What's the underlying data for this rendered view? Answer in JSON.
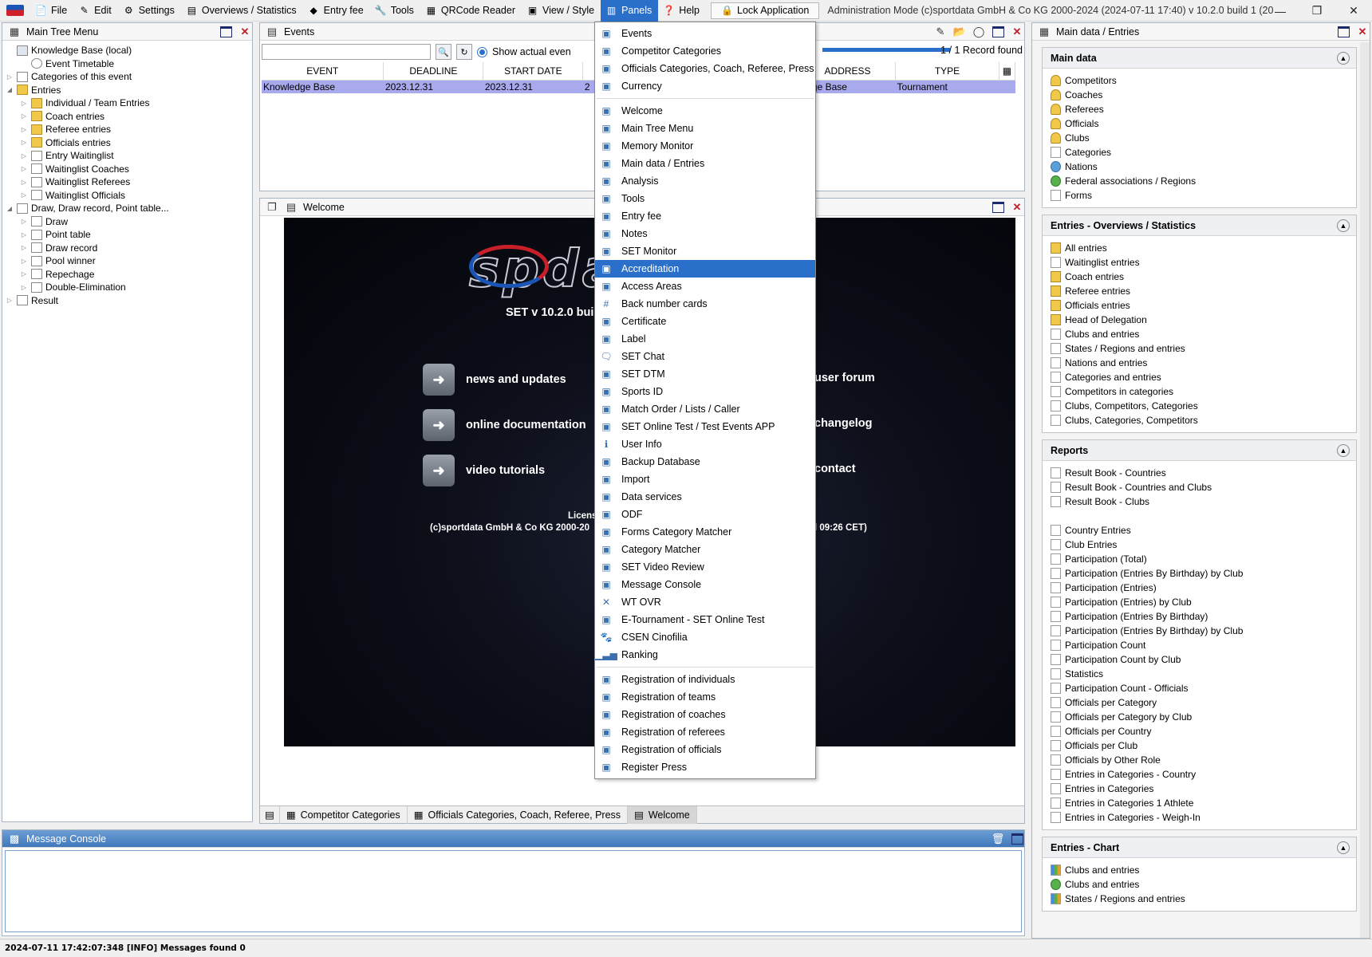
{
  "menubar": {
    "items": [
      {
        "label": "File",
        "icon": "file-icon"
      },
      {
        "label": "Edit",
        "icon": "edit-icon"
      },
      {
        "label": "Settings",
        "icon": "gear-icon"
      },
      {
        "label": "Overviews / Statistics",
        "icon": "overview-icon"
      },
      {
        "label": "Entry fee",
        "icon": "money-icon"
      },
      {
        "label": "Tools",
        "icon": "wrench-icon"
      },
      {
        "label": "QRCode Reader",
        "icon": "qrcode-icon"
      },
      {
        "label": "View / Style",
        "icon": "view-icon"
      },
      {
        "label": "Panels",
        "icon": "panels-icon"
      },
      {
        "label": "Help",
        "icon": "help-icon"
      }
    ],
    "lock_label": "Lock Application",
    "title": "Administration Mode (c)sportdata GmbH & Co KG 2000-2024 (2024-07-11 17:40)  v 10.2.0 build 1 (2024-06..."
  },
  "main_tree": {
    "title": "Main Tree Menu",
    "items": [
      {
        "label": "Knowledge Base (local)",
        "level": 0,
        "icon": "database-icon"
      },
      {
        "label": "Event Timetable",
        "level": 1,
        "icon": "clock-icon"
      },
      {
        "label": "Categories of this event",
        "level": 0,
        "icon": "categories-icon"
      },
      {
        "label": "Entries",
        "level": 0,
        "icon": "folder-icon"
      },
      {
        "label": "Individual / Team Entries",
        "level": 1,
        "icon": "folder-icon"
      },
      {
        "label": "Coach entries",
        "level": 1,
        "icon": "folder-icon"
      },
      {
        "label": "Referee entries",
        "level": 1,
        "icon": "folder-icon"
      },
      {
        "label": "Officials entries",
        "level": 1,
        "icon": "folder-icon"
      },
      {
        "label": "Entry Waitinglist",
        "level": 1,
        "icon": "document-icon"
      },
      {
        "label": "Waitinglist Coaches",
        "level": 1,
        "icon": "document-icon"
      },
      {
        "label": "Waitinglist Referees",
        "level": 1,
        "icon": "document-icon"
      },
      {
        "label": "Waitinglist Officials",
        "level": 1,
        "icon": "document-icon"
      },
      {
        "label": "Draw, Draw record, Point table...",
        "level": 0,
        "icon": "draw-icon"
      },
      {
        "label": "Draw",
        "level": 1,
        "icon": "list-icon"
      },
      {
        "label": "Point table",
        "level": 1,
        "icon": "list-icon"
      },
      {
        "label": "Draw record",
        "level": 1,
        "icon": "document-icon"
      },
      {
        "label": "Pool winner",
        "level": 1,
        "icon": "table-icon"
      },
      {
        "label": "Repechage",
        "level": 1,
        "icon": "document-icon"
      },
      {
        "label": "Double-Elimination",
        "level": 1,
        "icon": "bracket-icon"
      },
      {
        "label": "Result",
        "level": 0,
        "icon": "result-icon"
      }
    ]
  },
  "events": {
    "title": "Events",
    "show_actual_label": "Show actual even",
    "record_count": "1 / 1 Record found",
    "columns": [
      "EVENT",
      "DEADLINE",
      "START DATE",
      "ADDRESS",
      "TYPE"
    ],
    "row": {
      "event": "Knowledge Base",
      "deadline": "2023.12.31",
      "start": "2023.12.31",
      "start_cut": "2",
      "address": "edge Base",
      "type": "Tournament"
    }
  },
  "welcome": {
    "title": "Welcome",
    "version": "SET v 10.2.0 bui",
    "links": [
      "news and updates",
      "online documentation",
      "video tutorials",
      "user forum",
      "changelog",
      "contact"
    ],
    "license_line1": "License: SD",
    "license_line2": "(c)sportdata GmbH & Co KG 2000-20",
    "license_right": "l 09:26 CET)"
  },
  "center_tabs": [
    "Competitor Categories",
    "Officials Categories, Coach, Referee, Press",
    "Welcome"
  ],
  "panels_menu": {
    "group1": [
      {
        "label": "Events",
        "icon": "events-icon"
      },
      {
        "label": "Competitor Categories",
        "icon": "categories-icon"
      },
      {
        "label": "Officials Categories, Coach, Referee, Press",
        "icon": "officials-categories-icon"
      },
      {
        "label": "Currency",
        "icon": "currency-icon"
      }
    ],
    "group2": [
      {
        "label": "Welcome",
        "icon": "welcome-icon"
      },
      {
        "label": "Main Tree Menu",
        "icon": "tree-icon"
      },
      {
        "label": "Memory Monitor",
        "icon": "memory-icon"
      },
      {
        "label": "Main data / Entries",
        "icon": "main-data-icon"
      },
      {
        "label": "Analysis",
        "icon": "analysis-icon"
      },
      {
        "label": "Tools",
        "icon": "wrench-icon"
      },
      {
        "label": "Entry fee",
        "icon": "money-icon"
      },
      {
        "label": "Notes",
        "icon": "notes-icon"
      },
      {
        "label": "SET Monitor",
        "icon": "monitor-icon"
      },
      {
        "label": "Accreditation",
        "icon": "accreditation-icon"
      },
      {
        "label": "Access Areas",
        "icon": "access-icon"
      },
      {
        "label": "Back number cards",
        "icon": "hash-icon"
      },
      {
        "label": "Certificate",
        "icon": "certificate-icon"
      },
      {
        "label": "Label",
        "icon": "label-icon"
      },
      {
        "label": "SET Chat",
        "icon": "chat-icon"
      },
      {
        "label": "SET DTM",
        "icon": "dtm-icon"
      },
      {
        "label": "Sports ID",
        "icon": "sports-id-icon"
      },
      {
        "label": "Match Order / Lists / Caller",
        "icon": "match-order-icon"
      },
      {
        "label": "SET Online Test / Test Events APP",
        "icon": "online-test-icon"
      },
      {
        "label": "User Info",
        "icon": "info-icon"
      },
      {
        "label": "Backup Database",
        "icon": "backup-icon"
      },
      {
        "label": "Import",
        "icon": "import-icon"
      },
      {
        "label": "Data services",
        "icon": "data-services-icon"
      },
      {
        "label": "ODF",
        "icon": "odf-icon"
      },
      {
        "label": "Forms Category Matcher",
        "icon": "matcher-icon"
      },
      {
        "label": "Category Matcher",
        "icon": "matcher-icon"
      },
      {
        "label": "SET Video Review",
        "icon": "video-icon"
      },
      {
        "label": "Message Console",
        "icon": "console-icon"
      },
      {
        "label": "WT OVR",
        "icon": "wt-icon"
      },
      {
        "label": "E-Tournament - SET Online Test",
        "icon": "e-tournament-icon"
      },
      {
        "label": "CSEN Cinofilia",
        "icon": "paw-icon"
      },
      {
        "label": "Ranking",
        "icon": "ranking-icon"
      }
    ],
    "group3": [
      {
        "label": "Registration of individuals",
        "icon": "register-individual-icon"
      },
      {
        "label": "Registration of teams",
        "icon": "register-team-icon"
      },
      {
        "label": "Registration of coaches",
        "icon": "register-coach-icon"
      },
      {
        "label": "Registration of referees",
        "icon": "register-referee-icon"
      },
      {
        "label": "Registration of officials",
        "icon": "register-official-icon"
      },
      {
        "label": "Register Press",
        "icon": "press-icon"
      }
    ],
    "highlighted": "Accreditation"
  },
  "right_panel": {
    "title": "Main data / Entries",
    "sections": [
      {
        "title": "Main data",
        "items": [
          {
            "label": "Competitors",
            "icon": "person-icon"
          },
          {
            "label": "Coaches",
            "icon": "person-icon"
          },
          {
            "label": "Referees",
            "icon": "person-icon"
          },
          {
            "label": "Officials",
            "icon": "person-icon"
          },
          {
            "label": "Clubs",
            "icon": "person-icon"
          },
          {
            "label": "Categories",
            "icon": "categories-icon"
          },
          {
            "label": "Nations",
            "icon": "globe-icon"
          },
          {
            "label": "Federal associations / Regions",
            "icon": "region-icon"
          },
          {
            "label": "Forms",
            "icon": "forms-icon"
          }
        ]
      },
      {
        "title": "Entries - Overviews / Statistics",
        "items": [
          {
            "label": "All entries",
            "icon": "folder-icon"
          },
          {
            "label": "Waitinglist entries",
            "icon": "document-icon"
          },
          {
            "label": "Coach entries",
            "icon": "folder-icon"
          },
          {
            "label": "Referee entries",
            "icon": "folder-icon"
          },
          {
            "label": "Officials entries",
            "icon": "folder-icon"
          },
          {
            "label": "Head of Delegation",
            "icon": "folder-icon"
          },
          {
            "label": "Clubs and entries",
            "icon": "document-icon"
          },
          {
            "label": "States / Regions and entries",
            "icon": "document-icon"
          },
          {
            "label": "Nations and entries",
            "icon": "document-icon"
          },
          {
            "label": "Categories and entries",
            "icon": "document-icon"
          },
          {
            "label": "Competitors in categories",
            "icon": "document-icon"
          },
          {
            "label": "Clubs, Competitors, Categories",
            "icon": "document-icon"
          },
          {
            "label": "Clubs, Categories, Competitors",
            "icon": "document-icon"
          }
        ]
      },
      {
        "title": "Reports",
        "items": [
          {
            "label": "Result Book - Countries",
            "icon": "report-icon"
          },
          {
            "label": "Result Book - Countries and Clubs",
            "icon": "report-icon"
          },
          {
            "label": "Result Book - Clubs",
            "icon": "report-icon"
          },
          {
            "label": "",
            "icon": "gap"
          },
          {
            "label": "Country Entries",
            "icon": "report-icon"
          },
          {
            "label": "Club Entries",
            "icon": "report-icon"
          },
          {
            "label": "Participation (Total)",
            "icon": "report-icon"
          },
          {
            "label": "Participation (Entries By Birthday) by Club",
            "icon": "report-icon"
          },
          {
            "label": "Participation (Entries)",
            "icon": "report-icon"
          },
          {
            "label": "Participation (Entries) by Club",
            "icon": "report-icon"
          },
          {
            "label": "Participation (Entries By Birthday)",
            "icon": "report-icon"
          },
          {
            "label": "Participation (Entries By Birthday) by Club",
            "icon": "report-icon"
          },
          {
            "label": "Participation Count",
            "icon": "report-icon"
          },
          {
            "label": "Participation Count by Club",
            "icon": "report-icon"
          },
          {
            "label": "Statistics",
            "icon": "report-icon"
          },
          {
            "label": "Participation Count - Officials",
            "icon": "report-icon"
          },
          {
            "label": "Officials per Category",
            "icon": "report-icon"
          },
          {
            "label": "Officials per Category by Club",
            "icon": "report-icon"
          },
          {
            "label": "Officials per Country",
            "icon": "report-icon"
          },
          {
            "label": "Officials per Club",
            "icon": "report-icon"
          },
          {
            "label": "Officials by Other Role",
            "icon": "report-icon"
          },
          {
            "label": "Entries in Categories - Country",
            "icon": "report-icon"
          },
          {
            "label": "Entries in Categories",
            "icon": "report-icon"
          },
          {
            "label": "Entries in Categories 1 Athlete",
            "icon": "report-icon"
          },
          {
            "label": "Entries in Categories - Weigh-In",
            "icon": "report-icon"
          }
        ]
      },
      {
        "title": "Entries - Chart",
        "items": [
          {
            "label": "Clubs and entries",
            "icon": "chart-icon"
          },
          {
            "label": "Clubs and entries",
            "icon": "pie-icon"
          },
          {
            "label": "States / Regions and entries",
            "icon": "chart-icon"
          }
        ]
      }
    ]
  },
  "message_console": {
    "title": "Message Console"
  },
  "status": "2024-07-11 17:42:07:348 [INFO] Messages found 0"
}
